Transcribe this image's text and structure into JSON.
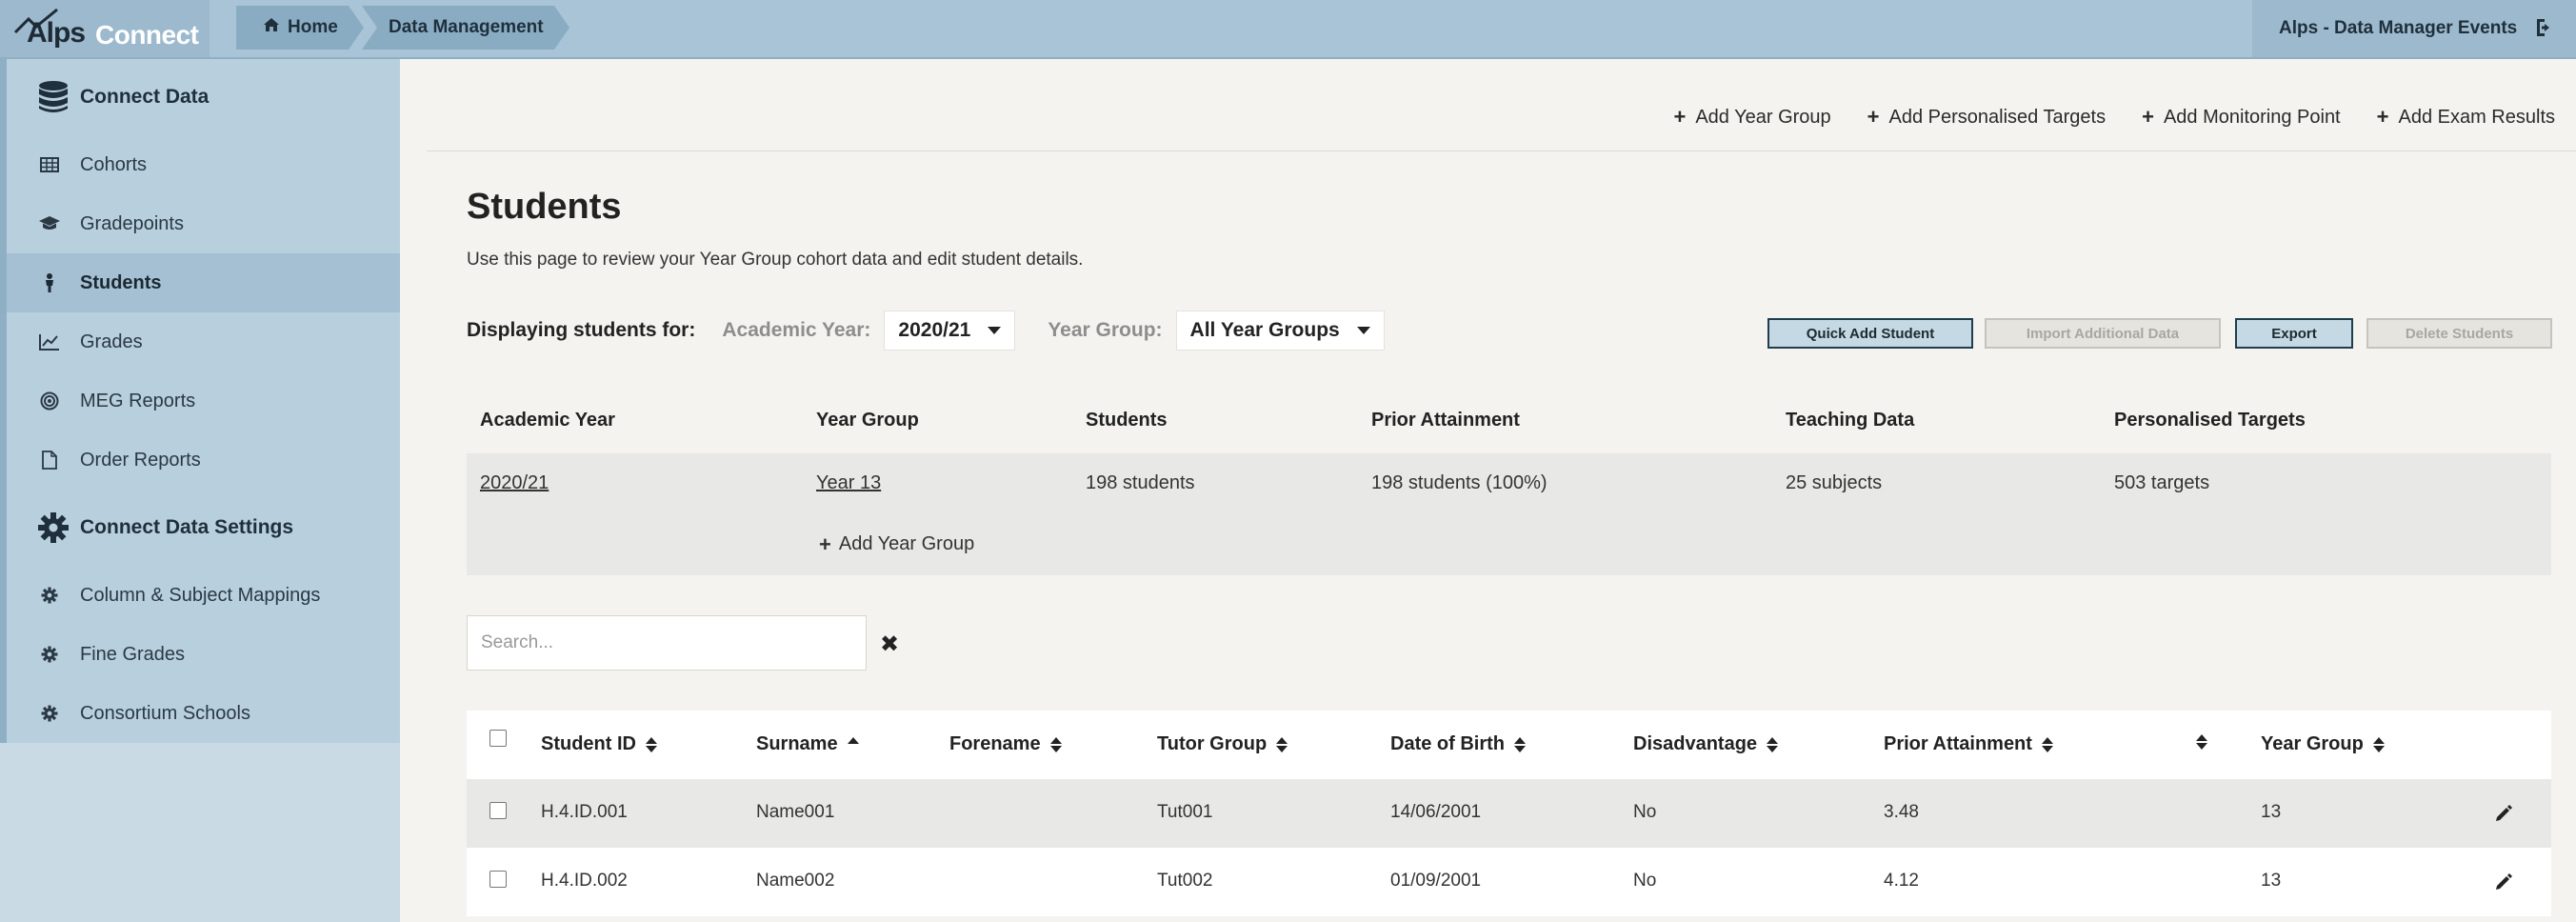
{
  "brand": {
    "logo_primary": "Alps",
    "logo_secondary": "Connect"
  },
  "breadcrumb": {
    "home": "Home",
    "current": "Data Management"
  },
  "user": {
    "name": "Alps - Data Manager Events"
  },
  "sidebar": {
    "section1": "Connect Data",
    "items1": [
      "Cohorts",
      "Gradepoints",
      "Students",
      "Grades",
      "MEG Reports",
      "Order Reports"
    ],
    "section2": "Connect Data Settings",
    "items2": [
      "Column & Subject Mappings",
      "Fine Grades",
      "Consortium Schools"
    ]
  },
  "actions": [
    "Add Year Group",
    "Add Personalised Targets",
    "Add Monitoring Point",
    "Add Exam Results"
  ],
  "page": {
    "title": "Students",
    "description": "Use this page to review your Year Group cohort data and edit student details."
  },
  "filters": {
    "lead": "Displaying students for:",
    "academic_year_label": "Academic Year:",
    "academic_year_value": "2020/21",
    "year_group_label": "Year Group:",
    "year_group_value": "All Year Groups"
  },
  "buttons": {
    "quick_add": "Quick Add Student",
    "import": "Import Additional Data",
    "export": "Export",
    "delete": "Delete Students"
  },
  "cohort_table": {
    "headers": [
      "Academic Year",
      "Year Group",
      "Students",
      "Prior Attainment",
      "Teaching Data",
      "Personalised Targets"
    ],
    "row": [
      "2020/21",
      "Year 13",
      "198 students",
      "198 students (100%)",
      "25 subjects",
      "503 targets"
    ],
    "add_label": "Add Year Group"
  },
  "search": {
    "placeholder": "Search..."
  },
  "student_table": {
    "headers": [
      "Student ID",
      "Surname",
      "Forename",
      "Tutor Group",
      "Date of Birth",
      "Disadvantage",
      "Prior Attainment",
      "",
      "Year Group"
    ],
    "rows": [
      [
        "H.4.ID.001",
        "Name001",
        "",
        "Tut001",
        "14/06/2001",
        "No",
        "3.48",
        "",
        "13"
      ],
      [
        "H.4.ID.002",
        "Name002",
        "",
        "Tut002",
        "01/09/2001",
        "No",
        "4.12",
        "",
        "13"
      ]
    ]
  }
}
